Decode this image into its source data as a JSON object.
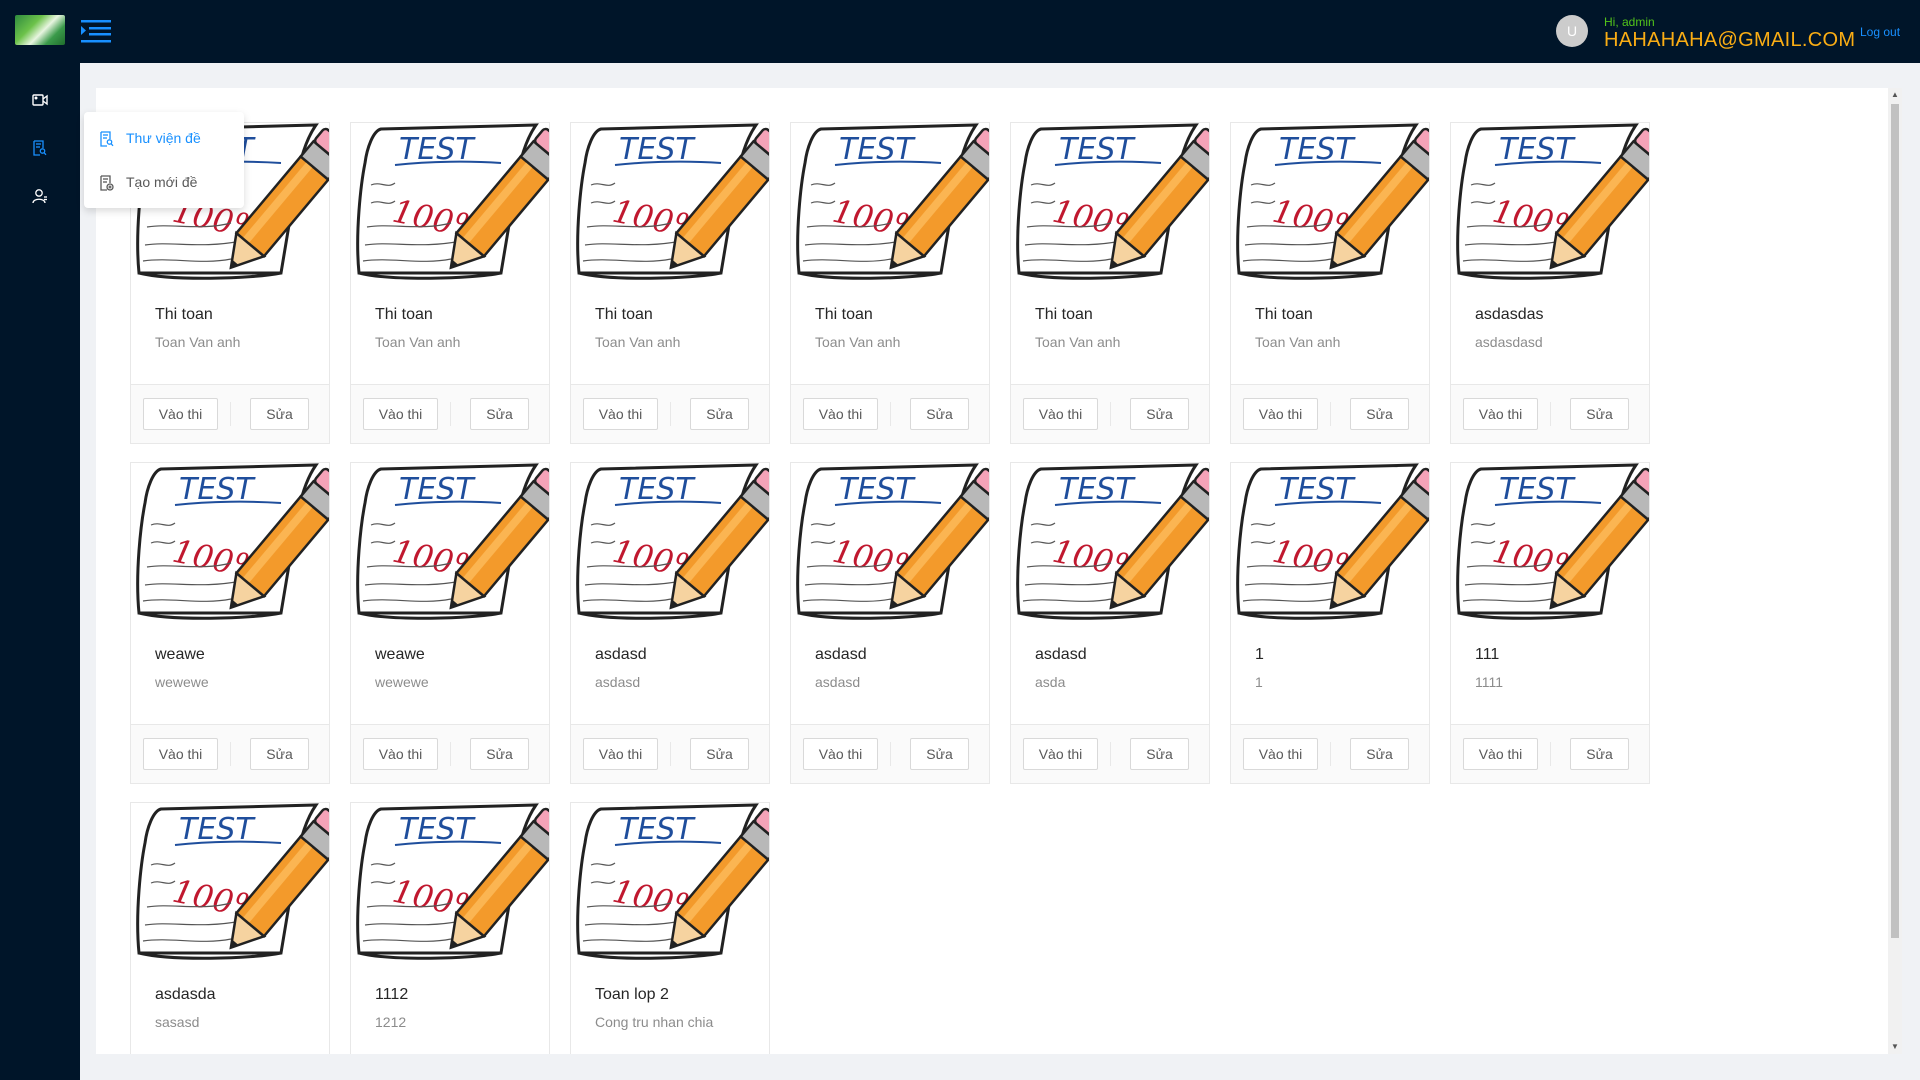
{
  "header": {
    "avatar_letter": "U",
    "greeting": "Hi, admin",
    "email": "HAHAHAHA@GMAIL.COM",
    "logout": "Log out"
  },
  "sidebar": {
    "items": [
      {
        "icon": "video-camera-icon"
      },
      {
        "icon": "file-search-icon"
      },
      {
        "icon": "user-icon"
      }
    ]
  },
  "submenu": {
    "items": [
      {
        "label": "Thư viện đề",
        "icon": "file-search-icon",
        "active": true
      },
      {
        "label": "Tạo mới đề",
        "icon": "file-add-icon",
        "active": false
      }
    ]
  },
  "card_actions": {
    "enter": "Vào thi",
    "edit": "Sửa"
  },
  "cards": [
    {
      "title": "Thi toan",
      "desc": "Toan Van anh"
    },
    {
      "title": "Thi toan",
      "desc": "Toan Van anh"
    },
    {
      "title": "Thi toan",
      "desc": "Toan Van anh"
    },
    {
      "title": "Thi toan",
      "desc": "Toan Van anh"
    },
    {
      "title": "Thi toan",
      "desc": "Toan Van anh"
    },
    {
      "title": "Thi toan",
      "desc": "Toan Van anh"
    },
    {
      "title": "asdasdas",
      "desc": "asdasdasd"
    },
    {
      "title": "weawe",
      "desc": "wewewe"
    },
    {
      "title": "weawe",
      "desc": "wewewe"
    },
    {
      "title": "asdasd",
      "desc": "asdasd"
    },
    {
      "title": "asdasd",
      "desc": "asdasd"
    },
    {
      "title": "asdasd",
      "desc": "asda"
    },
    {
      "title": "1",
      "desc": "1"
    },
    {
      "title": "111",
      "desc": "1111"
    },
    {
      "title": "asdasda",
      "desc": "sasasd"
    },
    {
      "title": "1112",
      "desc": "1212"
    },
    {
      "title": "Toan lop 2",
      "desc": "Cong tru nhan chia"
    }
  ],
  "cover": {
    "word": "TEST",
    "score": "100%"
  },
  "colors": {
    "header_bg": "#001529",
    "accent": "#1890ff",
    "email": "#faad14",
    "greeting": "#52c41a"
  }
}
